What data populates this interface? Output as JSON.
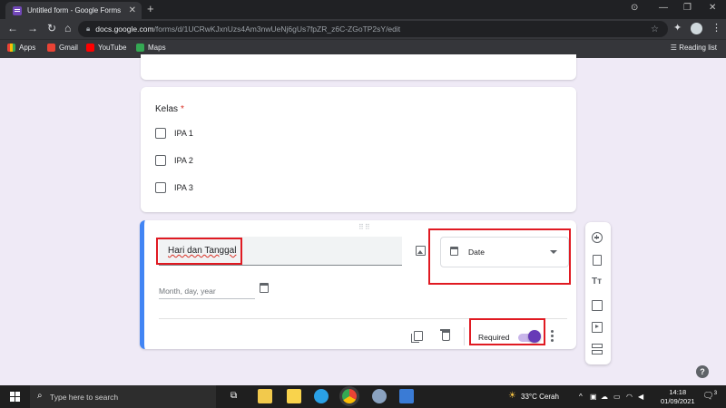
{
  "browser": {
    "tab_title": "Untitled form - Google Forms",
    "tab_close": "✕",
    "new_tab": "+",
    "url_host": "docs.google.com",
    "url_path": "/forms/d/1UCRwKJxnUzs4Am3nwUeNj6gUs7fpZR_z6C-ZGoTP2sY/edit",
    "bookmarks": [
      "Apps",
      "Gmail",
      "YouTube",
      "Maps"
    ],
    "reading_list": "Reading list"
  },
  "form": {
    "question_kelas": {
      "title": "Kelas",
      "required_mark": "*",
      "options": [
        "IPA 1",
        "IPA 2",
        "IPA 3"
      ]
    },
    "question_active": {
      "title": "Hari dan Tanggal",
      "type_label": "Date",
      "date_placeholder": "Month, day, year",
      "required_label": "Required",
      "required_on": true
    },
    "help": "?"
  },
  "taskbar": {
    "search_placeholder": "Type here to search",
    "weather": "33°C  Cerah",
    "time": "14:18",
    "date": "01/09/2021",
    "notification_count": "3"
  },
  "colors": {
    "accent_purple": "#673ab7",
    "active_blue": "#4285f4",
    "highlight_red": "#e01a22"
  }
}
